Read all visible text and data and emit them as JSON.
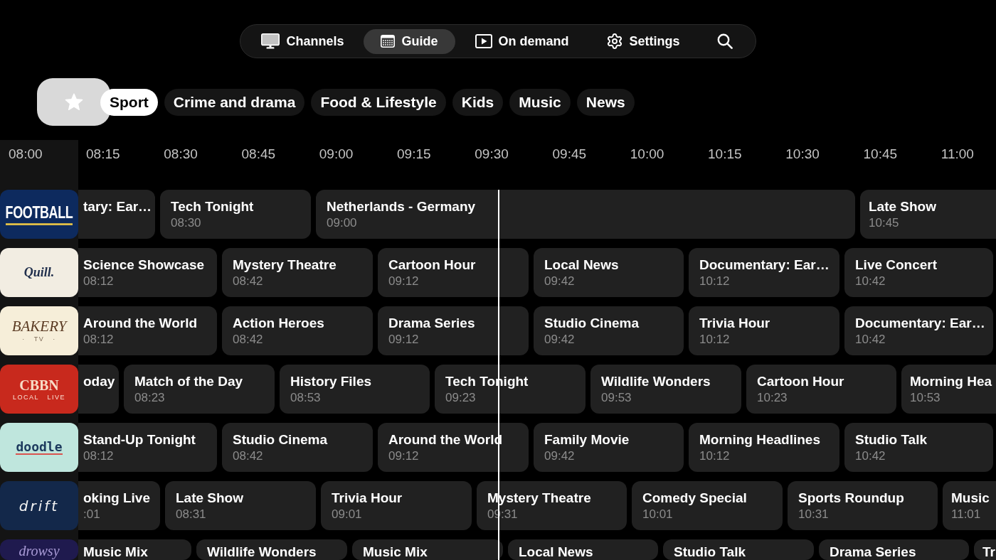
{
  "nav": {
    "items": [
      {
        "kind": "channels",
        "label": "Channels",
        "selected": false
      },
      {
        "kind": "guide",
        "label": "Guide",
        "selected": true
      },
      {
        "kind": "demand",
        "label": "On demand",
        "selected": false
      },
      {
        "kind": "settings",
        "label": "Settings",
        "selected": false
      }
    ]
  },
  "favorites_button": {
    "focused": true
  },
  "categories": [
    {
      "label": "Sport",
      "selected": true
    },
    {
      "label": "Crime and drama",
      "selected": false
    },
    {
      "label": "Food & Lifestyle",
      "selected": false
    },
    {
      "label": "Kids",
      "selected": false
    },
    {
      "label": "Music",
      "selected": false
    },
    {
      "label": "News",
      "selected": false
    }
  ],
  "timeline": {
    "ticks": [
      "08:00",
      "08:15",
      "08:30",
      "08:45",
      "09:00",
      "09:15",
      "09:30",
      "09:45",
      "10:00",
      "10:15",
      "10:30",
      "10:45",
      "11:00"
    ]
  },
  "channels": [
    {
      "logo": {
        "kind": "football",
        "name": "FOOTBALL"
      },
      "programs": [
        {
          "title": "tary: Ear…"
        },
        {
          "title": "Tech Tonight",
          "start": "08:30"
        },
        {
          "title": "Netherlands - Germany",
          "start": "09:00"
        },
        {
          "title": "Late Show",
          "start": "10:45"
        }
      ]
    },
    {
      "logo": {
        "kind": "quill",
        "name": "Quill."
      },
      "programs": [
        {
          "title": "Science Showcase",
          "start": "08:12"
        },
        {
          "title": "Mystery Theatre",
          "start": "08:42"
        },
        {
          "title": "Cartoon Hour",
          "start": "09:12"
        },
        {
          "title": "Local News",
          "start": "09:42"
        },
        {
          "title": "Documentary: Ear…",
          "start": "10:12"
        },
        {
          "title": "Live Concert",
          "start": "10:42"
        }
      ]
    },
    {
      "logo": {
        "kind": "bakery",
        "name": "BAKERY",
        "tagline": "· TV ·"
      },
      "programs": [
        {
          "title": "Around the World",
          "start": "08:12"
        },
        {
          "title": "Action Heroes",
          "start": "08:42"
        },
        {
          "title": "Drama Series",
          "start": "09:12"
        },
        {
          "title": "Studio Cinema",
          "start": "09:42"
        },
        {
          "title": "Trivia Hour",
          "start": "10:12"
        },
        {
          "title": "Documentary: Ear…",
          "start": "10:42"
        }
      ]
    },
    {
      "logo": {
        "kind": "cbbn",
        "name": "CBBN",
        "tagline": "LOCAL LIVE"
      },
      "programs": [
        {
          "title": "oday"
        },
        {
          "title": "Match of the Day",
          "start": "08:23"
        },
        {
          "title": "History Files",
          "start": "08:53"
        },
        {
          "title": "Tech Tonight",
          "start": "09:23"
        },
        {
          "title": "Wildlife Wonders",
          "start": "09:53"
        },
        {
          "title": "Cartoon Hour",
          "start": "10:23"
        },
        {
          "title": "Morning Hea",
          "start": "10:53"
        }
      ]
    },
    {
      "logo": {
        "kind": "doodle",
        "name": "doodle"
      },
      "programs": [
        {
          "title": "Stand-Up Tonight",
          "start": "08:12"
        },
        {
          "title": "Studio Cinema",
          "start": "08:42"
        },
        {
          "title": "Around the World",
          "start": "09:12"
        },
        {
          "title": "Family Movie",
          "start": "09:42"
        },
        {
          "title": "Morning Headlines",
          "start": "10:12"
        },
        {
          "title": "Studio Talk",
          "start": "10:42"
        }
      ]
    },
    {
      "logo": {
        "kind": "drift",
        "name": "drift"
      },
      "programs": [
        {
          "title": "oking Live",
          "start": ":01"
        },
        {
          "title": "Late Show",
          "start": "08:31"
        },
        {
          "title": "Trivia Hour",
          "start": "09:01"
        },
        {
          "title": "Mystery Theatre",
          "start": "09:31"
        },
        {
          "title": "Comedy Special",
          "start": "10:01"
        },
        {
          "title": "Sports Roundup",
          "start": "10:31"
        },
        {
          "title": "Music",
          "start": "11:01"
        }
      ]
    },
    {
      "logo": {
        "kind": "drowsy",
        "name": "drowsy"
      },
      "programs": [
        {
          "title": "Music Mix"
        },
        {
          "title": "Wildlife Wonders"
        },
        {
          "title": "Music Mix"
        },
        {
          "title": "Local News"
        },
        {
          "title": "Studio Talk"
        },
        {
          "title": "Drama Series"
        },
        {
          "title": "Tr"
        }
      ]
    }
  ]
}
